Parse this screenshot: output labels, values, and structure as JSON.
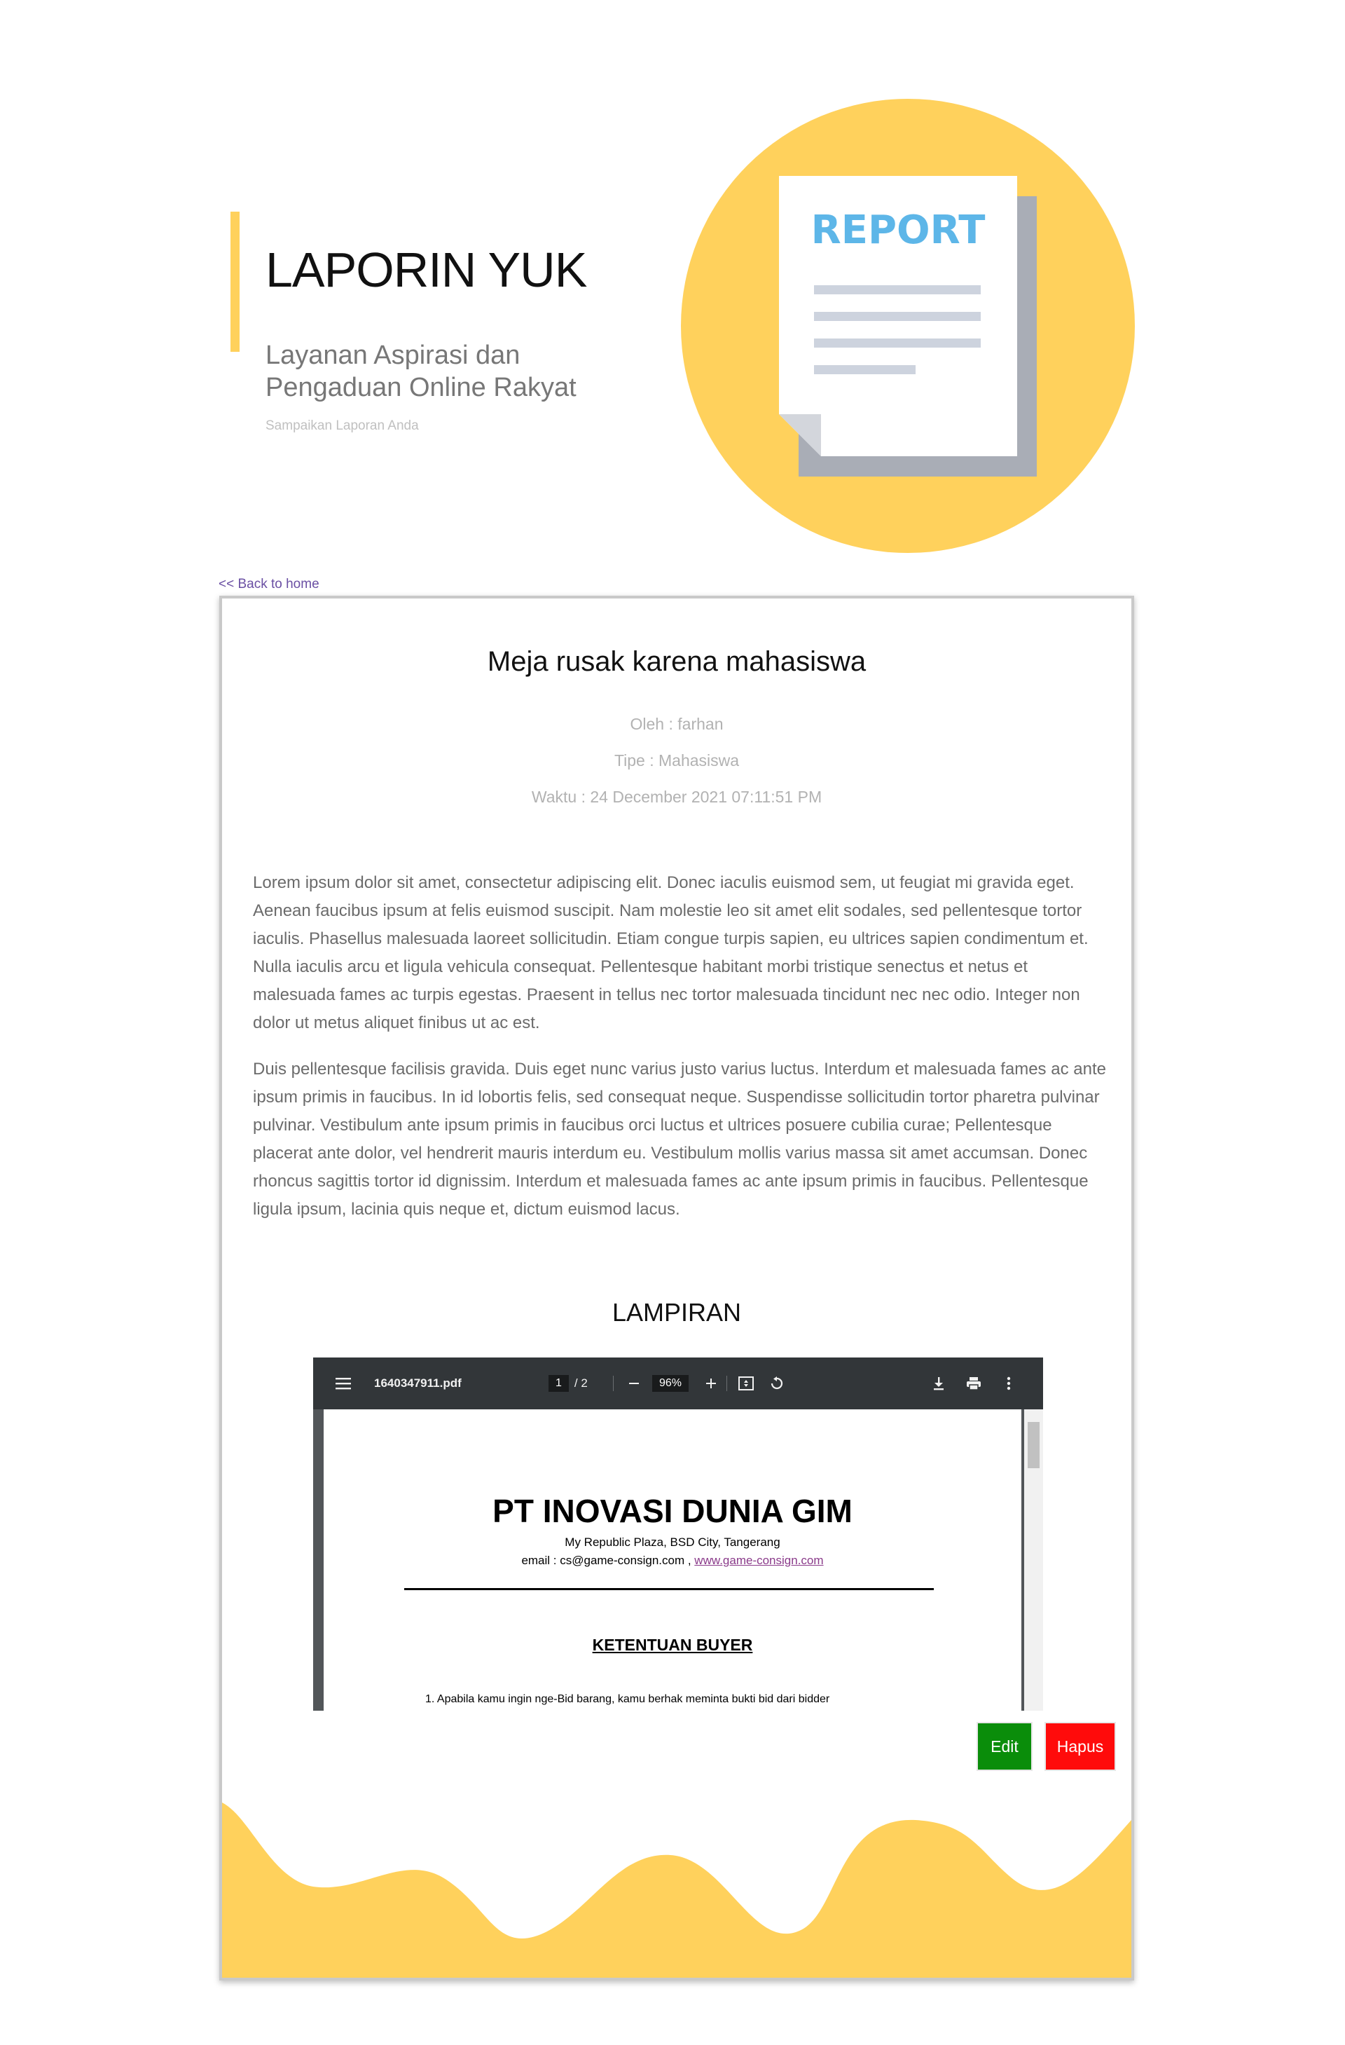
{
  "hero": {
    "title": "LAPORIN YUK",
    "subtitle": "Layanan Aspirasi dan Pengaduan Online Rakyat",
    "tagline": "Sampaikan Laporan Anda",
    "illustration_text": "REPORT"
  },
  "nav": {
    "back_label": "<< Back to home"
  },
  "report": {
    "title": "Meja rusak karena mahasiswa",
    "author": "Oleh : farhan",
    "type": "Tipe : Mahasiswa",
    "time": "Waktu : 24 December 2021 07:11:51 PM",
    "paragraphs": [
      "Lorem ipsum dolor sit amet, consectetur adipiscing elit. Donec iaculis euismod sem, ut feugiat mi gravida eget. Aenean faucibus ipsum at felis euismod suscipit. Nam molestie leo sit amet elit sodales, sed pellentesque tortor iaculis. Phasellus malesuada laoreet sollicitudin. Etiam congue turpis sapien, eu ultrices sapien condimentum et. Nulla iaculis arcu et ligula vehicula consequat. Pellentesque habitant morbi tristique senectus et netus et malesuada fames ac turpis egestas. Praesent in tellus nec tortor malesuada tincidunt nec nec odio. Integer non dolor ut metus aliquet finibus ut ac est.",
      "Duis pellentesque facilisis gravida. Duis eget nunc varius justo varius luctus. Interdum et malesuada fames ac ante ipsum primis in faucibus. In id lobortis felis, sed consequat neque. Suspendisse sollicitudin tortor pharetra pulvinar pulvinar. Vestibulum ante ipsum primis in faucibus orci luctus et ultrices posuere cubilia curae; Pellentesque placerat ante dolor, vel hendrerit mauris interdum eu. Vestibulum mollis varius massa sit amet accumsan. Donec rhoncus sagittis tortor id dignissim. Interdum et malesuada fames ac ante ipsum primis in faucibus. Pellentesque ligula ipsum, lacinia quis neque et, dictum euismod lacus."
    ]
  },
  "attachment": {
    "heading": "LAMPIRAN",
    "viewer": {
      "filename": "1640347911.pdf",
      "page_current": "1",
      "page_total": "/  2",
      "zoom": "96%",
      "icons": [
        "menu-icon",
        "zoom-out-icon",
        "zoom-in-icon",
        "fit-page-icon",
        "rotate-icon",
        "download-icon",
        "print-icon",
        "more-icon"
      ]
    },
    "document": {
      "company": "PT INOVASI DUNIA GIM",
      "address": "My Republic Plaza, BSD City, Tangerang",
      "email_prefix": "email : cs@game-consign.com ,",
      "website": "www.game-consign.com",
      "section_title": "KETENTUAN BUYER",
      "item_1": "1.    Apabila kamu ingin nge-Bid barang, kamu berhak meminta bukti bid dari bidder"
    }
  },
  "actions": {
    "edit_label": "Edit",
    "delete_label": "Hapus"
  },
  "colors": {
    "accent_yellow": "#FFD15C",
    "report_blue": "#5DB6E8",
    "edit_green": "#0A8D0A",
    "delete_red": "#FF0B0B",
    "link_purple": "#6A4FA3"
  }
}
